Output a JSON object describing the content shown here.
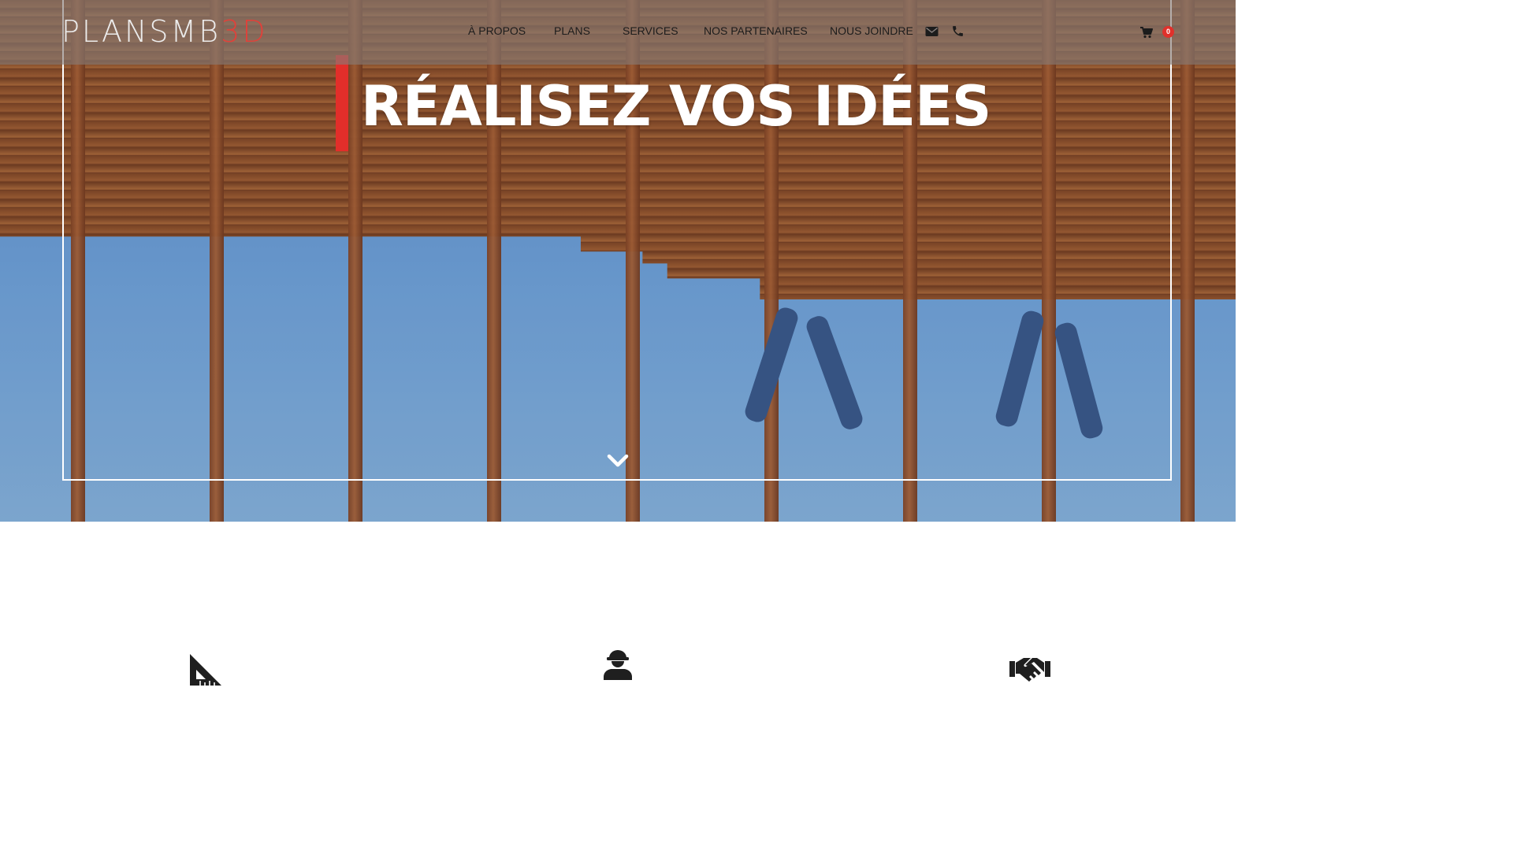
{
  "header": {
    "logo_part1": "PLANSMB",
    "logo_part2": "3D"
  },
  "nav": {
    "items": [
      {
        "label": "À PROPOS"
      },
      {
        "label": "PLANS"
      },
      {
        "label": "SERVICES"
      },
      {
        "label": "NOS PARTENAIRES"
      },
      {
        "label": "NOUS JOINDRE"
      }
    ],
    "contact_icons": [
      "envelope-icon",
      "phone-icon"
    ],
    "cart_count": "0"
  },
  "hero": {
    "headline": "RÉALISEZ VOS IDÉES",
    "scroll_icon": "chevron-down-icon"
  },
  "features": {
    "icons": [
      "set-square-ruler-icon",
      "construction-worker-icon",
      "handshake-icon"
    ]
  },
  "colors": {
    "accent": "#e22e2a",
    "nav_text": "#1c1c1c",
    "headline": "#ffffff"
  }
}
